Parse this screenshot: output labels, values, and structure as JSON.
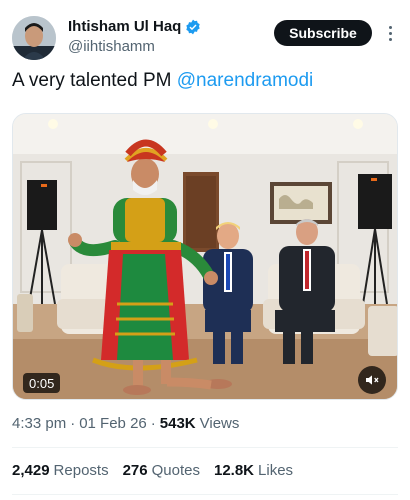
{
  "author": {
    "display_name": "Ihtisham Ul Haq",
    "handle": "@iihtishamm",
    "verified": true
  },
  "actions": {
    "subscribe_label": "Subscribe"
  },
  "tweet": {
    "text_prefix": "A very talented PM ",
    "mention": "@narendramodi"
  },
  "media": {
    "duration": "0:05"
  },
  "meta": {
    "time": "4:33 pm",
    "separator1": "·",
    "date": "01 Feb 26",
    "separator2": "·",
    "views_count": "543K",
    "views_label": "Views"
  },
  "stats": {
    "reposts_count": "2,429",
    "reposts_label": "Reposts",
    "quotes_count": "276",
    "quotes_label": "Quotes",
    "likes_count": "12.8K",
    "likes_label": "Likes"
  },
  "colors": {
    "accent": "#1d9bf0",
    "text": "#0f1419",
    "muted": "#536471"
  }
}
